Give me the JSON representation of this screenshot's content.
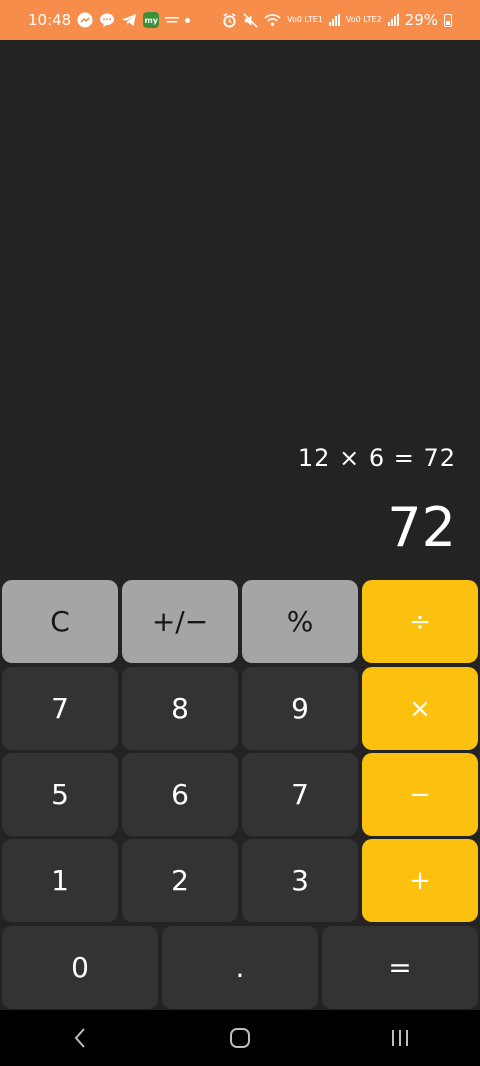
{
  "status_bar": {
    "time": "10:48",
    "battery": "29%",
    "carrier1": "Vo0 LTE1",
    "carrier2": "Vo0 LTE2"
  },
  "display": {
    "expression": "12 × 6 = 72",
    "result": "72"
  },
  "keypad": {
    "rows": [
      [
        {
          "label": "C",
          "style": "light"
        },
        {
          "label": "+/−",
          "style": "light"
        },
        {
          "label": "%",
          "style": "light"
        },
        {
          "label": "÷",
          "style": "op"
        }
      ],
      [
        {
          "label": "7",
          "style": "dark"
        },
        {
          "label": "8",
          "style": "dark"
        },
        {
          "label": "9",
          "style": "dark"
        },
        {
          "label": "×",
          "style": "op"
        }
      ],
      [
        {
          "label": "5",
          "style": "dark"
        },
        {
          "label": "6",
          "style": "dark"
        },
        {
          "label": "7",
          "style": "dark"
        },
        {
          "label": "−",
          "style": "op"
        }
      ],
      [
        {
          "label": "1",
          "style": "dark"
        },
        {
          "label": "2",
          "style": "dark"
        },
        {
          "label": "3",
          "style": "dark"
        },
        {
          "label": "+",
          "style": "op"
        }
      ]
    ],
    "bottom_row": [
      {
        "label": "0"
      },
      {
        "label": "."
      },
      {
        "label": "="
      }
    ]
  },
  "colors": {
    "status_bar": "#f78d4b",
    "background": "#232323",
    "key_light": "#a5a5a5",
    "key_dark": "#333333",
    "key_operator": "#fcc10e"
  },
  "nav_bar": {
    "icons": [
      "back-icon",
      "home-icon",
      "recents-icon"
    ]
  }
}
